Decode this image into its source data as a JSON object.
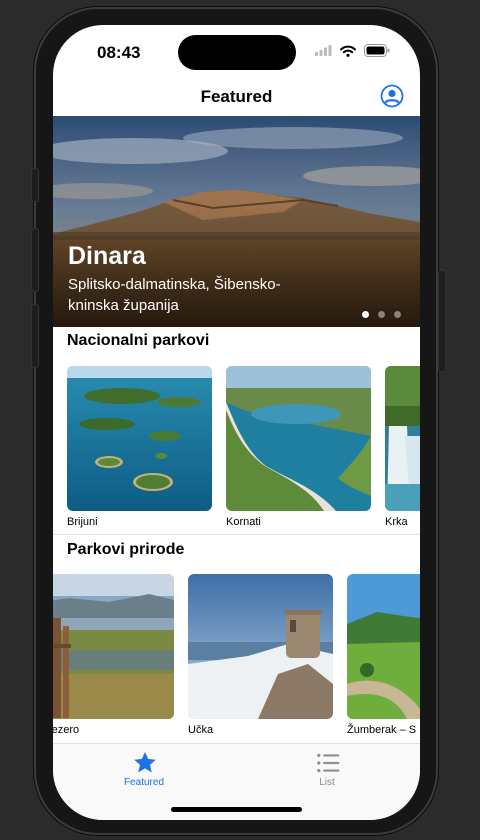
{
  "status_bar": {
    "time": "08:43"
  },
  "nav": {
    "title": "Featured"
  },
  "hero": {
    "title": "Dinara",
    "subtitle": "Splitsko-dalmatinska, Šibensko-kninska županija",
    "page_count": 3,
    "active_page": 1
  },
  "sections": [
    {
      "title": "Nacionalni parkovi",
      "items": [
        "Brijuni",
        "Kornati",
        "Krka"
      ]
    },
    {
      "title": "Parkovi prirode",
      "items": [
        "sko jezero",
        "Učka",
        "Žumberak – S"
      ]
    }
  ],
  "tabs": [
    {
      "label": "Featured",
      "icon": "star-icon",
      "selected": true
    },
    {
      "label": "List",
      "icon": "list-icon",
      "selected": false
    }
  ],
  "colors": {
    "accent": "#1a73e8",
    "tab_inactive": "#8e8e93"
  }
}
